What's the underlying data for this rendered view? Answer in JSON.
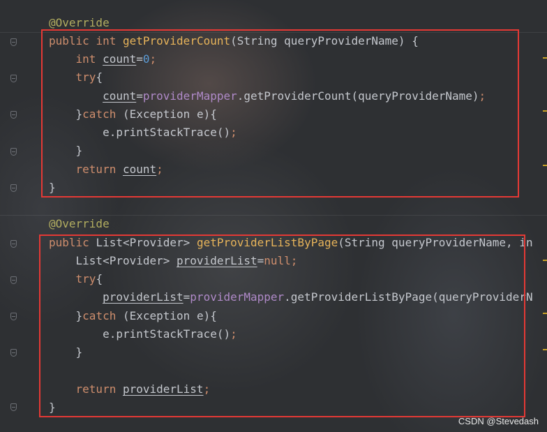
{
  "code": {
    "method1": {
      "annotation": "@Override",
      "kw_public": "public",
      "kw_int": "int",
      "name": "getProviderCount",
      "params": "(String queryProviderName) {",
      "decl_type": "int",
      "decl_var": "count",
      "decl_eq": "=",
      "decl_val": "0",
      "decl_semi": ";",
      "kw_try": "try",
      "brace_open": "{",
      "assign_var": "count",
      "assign_eq": "=",
      "assign_field": "providerMapper",
      "assign_call": ".getProviderCount(queryProviderName)",
      "assign_semi": ";",
      "catch_close": "}",
      "kw_catch": "catch",
      "catch_rest": " (Exception e){",
      "print": "e.printStackTrace()",
      "print_semi": ";",
      "close_try": "}",
      "kw_return": "return",
      "return_var": "count",
      "return_semi": ";",
      "close_method": "}"
    },
    "method2": {
      "annotation": "@Override",
      "kw_public": "public",
      "type": "List<Provider>",
      "name": "getProviderListByPage",
      "params": "(String queryProviderName, in",
      "decl_type": "List<Provider>",
      "decl_var": "providerList",
      "decl_eq": "=",
      "decl_val": "null",
      "decl_semi": ";",
      "kw_try": "try",
      "brace_open": "{",
      "assign_var": "providerList",
      "assign_eq": "=",
      "assign_field": "providerMapper",
      "assign_call": ".getProviderListByPage(queryProviderN",
      "catch_close": "}",
      "kw_catch": "catch",
      "catch_rest": " (Exception e){",
      "print": "e.printStackTrace()",
      "print_semi": ";",
      "close_try": "}",
      "kw_return": "return",
      "return_var": "providerList",
      "return_semi": ";",
      "close_method": "}"
    }
  },
  "watermark": "CSDN @Stevedash",
  "colors": {
    "highlight_box": "#e53935",
    "keyword": "#cf8e6d",
    "method": "#e8b45a",
    "field": "#b08ac9",
    "number": "#5b9bd5",
    "annotation": "#b3ae60"
  }
}
